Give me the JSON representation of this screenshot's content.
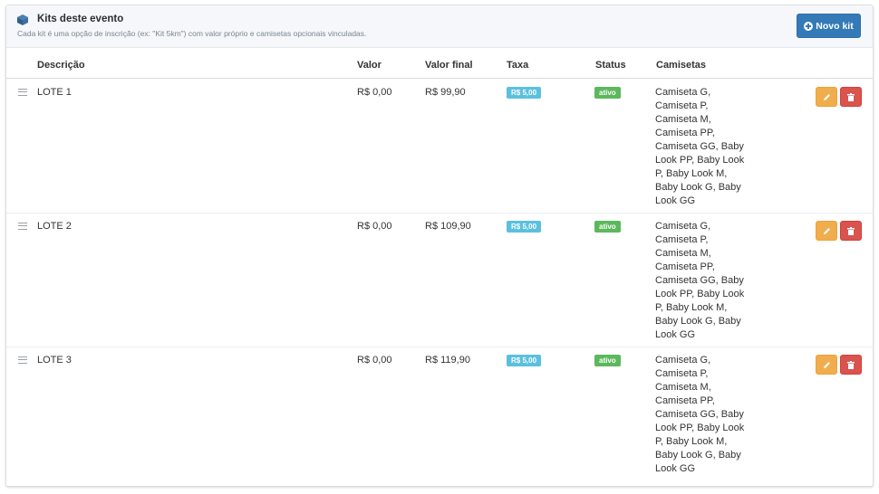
{
  "panel": {
    "title": "Kits deste evento",
    "subtitle": "Cada kit é uma opção de inscrição (ex: \"Kit 5km\") com valor próprio e camisetas opcionais vinculadas.",
    "new_button_label": "Novo kit",
    "icons": {
      "header": "cube-icon",
      "new": "plus-circle-icon",
      "edit": "pencil-icon",
      "delete": "trash-icon",
      "drag": "drag-handle-icon"
    }
  },
  "table": {
    "columns": {
      "descricao": "Descrição",
      "valor": "Valor",
      "valor_final": "Valor final",
      "taxa": "Taxa",
      "status": "Status",
      "camisetas": "Camisetas"
    },
    "rows": [
      {
        "descricao": "LOTE 1",
        "valor": "R$ 0,00",
        "valor_final": "R$ 99,90",
        "taxa": "R$ 5,00",
        "status": "ativo",
        "camisetas": "Camiseta G, Camiseta P, Camiseta M, Camiseta PP, Camiseta GG, Baby Look PP, Baby Look P, Baby Look M, Baby Look G, Baby Look GG"
      },
      {
        "descricao": "LOTE 2",
        "valor": "R$ 0,00",
        "valor_final": "R$ 109,90",
        "taxa": "R$ 5,00",
        "status": "ativo",
        "camisetas": "Camiseta G, Camiseta P, Camiseta M, Camiseta PP, Camiseta GG, Baby Look PP, Baby Look P, Baby Look M, Baby Look G, Baby Look GG"
      },
      {
        "descricao": "LOTE 3",
        "valor": "R$ 0,00",
        "valor_final": "R$ 119,90",
        "taxa": "R$ 5,00",
        "status": "ativo",
        "camisetas": "Camiseta G, Camiseta P, Camiseta M, Camiseta PP, Camiseta GG, Baby Look PP, Baby Look P, Baby Look M, Baby Look G, Baby Look GG"
      }
    ]
  },
  "colors": {
    "primary": "#337ab7",
    "info": "#5bc0de",
    "success": "#5cb85c",
    "warning": "#f0ad4e",
    "danger": "#d9534f"
  }
}
